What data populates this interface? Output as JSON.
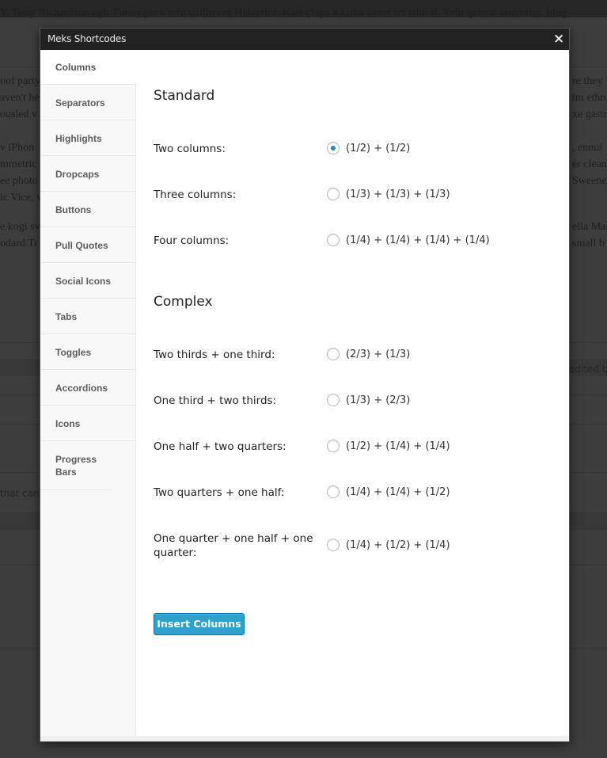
{
  "background": {
    "lines": [
      "Y, Terry Richardson ugh. Fanny pack tofu chillwave Helvetica. Kale chips 4 Loko street art ethical. Tofu quinoa semiotics, blog",
      "oof party",
      "aven't he",
      "ousled v",
      "v iPhon",
      "mmetric",
      "ee photo",
      "ic Vice, v",
      "e kogi sv",
      "odard Tr"
    ],
    "right_lines": [
      "re they",
      "im ethn",
      "xe gastr",
      ", ennui",
      "er clean",
      "Sweeney",
      "ella Mar",
      "small b"
    ],
    "side_text_left": "that can",
    "side_text_right": "edited by"
  },
  "modal": {
    "title": "Meks Shortcodes",
    "close_icon": "×",
    "sidebar": {
      "items": [
        {
          "label": "Columns",
          "active": true
        },
        {
          "label": "Separators"
        },
        {
          "label": "Highlights"
        },
        {
          "label": "Dropcaps"
        },
        {
          "label": "Buttons"
        },
        {
          "label": "Pull Quotes"
        },
        {
          "label": "Social Icons"
        },
        {
          "label": "Tabs"
        },
        {
          "label": "Toggles"
        },
        {
          "label": "Accordions"
        },
        {
          "label": "Icons"
        },
        {
          "label": "Progress Bars"
        }
      ]
    },
    "content": {
      "standard_title": "Standard",
      "complex_title": "Complex",
      "standard": [
        {
          "label": "Two columns:",
          "option": "(1/2) + (1/2)",
          "checked": true
        },
        {
          "label": "Three columns:",
          "option": "(1/3) + (1/3) + (1/3)",
          "checked": false
        },
        {
          "label": "Four columns:",
          "option": "(1/4) + (1/4) + (1/4) + (1/4)",
          "checked": false
        }
      ],
      "complex": [
        {
          "label": "Two thirds + one third:",
          "option": "(2/3) + (1/3)",
          "checked": false
        },
        {
          "label": "One third + two thirds:",
          "option": "(1/3) + (2/3)",
          "checked": false
        },
        {
          "label": "One half + two quarters:",
          "option": "(1/2) + (1/4) + (1/4)",
          "checked": false
        },
        {
          "label": "Two quarters + one half:",
          "option": "(1/4) + (1/4) + (1/2)",
          "checked": false
        },
        {
          "label": "One quarter + one half + one quarter:",
          "option": "(1/4) + (1/2) + (1/4)",
          "checked": false
        }
      ],
      "insert_button": "Insert Columns"
    }
  },
  "colors": {
    "accent": "#2ea2cc",
    "radio_checked": "#1e8cbe",
    "header_bg": "#222222"
  }
}
